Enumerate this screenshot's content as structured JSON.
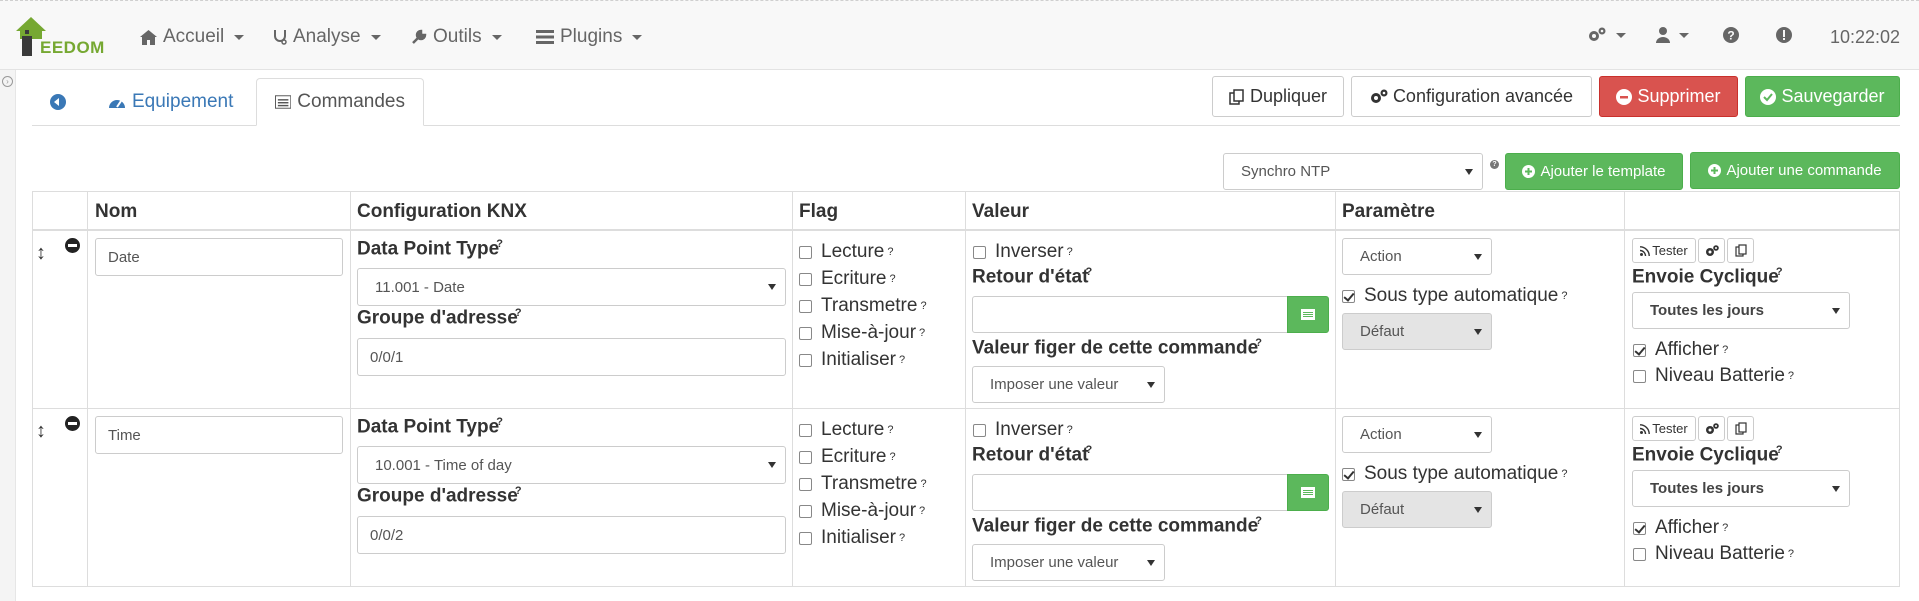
{
  "navbar": {
    "logo_text": "EEDOM",
    "menus": [
      {
        "label": "Accueil",
        "icon": "home-icon"
      },
      {
        "label": "Analyse",
        "icon": "stethoscope-icon"
      },
      {
        "label": "Outils",
        "icon": "wrench-icon"
      },
      {
        "label": "Plugins",
        "icon": "tasks-icon"
      }
    ],
    "time": "10:22:02"
  },
  "tabs": {
    "equipement": "Equipement",
    "commandes": "Commandes"
  },
  "actions": {
    "dupliquer": "Dupliquer",
    "config_avancee": "Configuration avancée",
    "supprimer": "Supprimer",
    "sauvegarder": "Sauvegarder"
  },
  "template_bar": {
    "template_select": "Synchro NTP",
    "add_template": "Ajouter le template",
    "add_command": "Ajouter une commande"
  },
  "table": {
    "headers": [
      "Nom",
      "Configuration KNX",
      "Flag",
      "Valeur",
      "Paramètre",
      ""
    ],
    "labels": {
      "dpt": "Data Point Type",
      "group": "Groupe d'adresse",
      "retour": "Retour d'état",
      "figer": "Valeur figer de cette commande",
      "envoie": "Envoie Cyclique",
      "tester": "Tester"
    },
    "flags": [
      "Lecture",
      "Ecriture",
      "Transmetre",
      "Mise-à-jour",
      "Initialiser"
    ],
    "inverser": "Inverser",
    "sous_type": "Sous type automatique",
    "afficher": "Afficher",
    "batterie": "Niveau Batterie",
    "rows": [
      {
        "nom": "Date",
        "dpt": "11.001 - Date",
        "group": "0/0/1",
        "impose": "Imposer une valeur",
        "type": "Action",
        "subtype": "Défaut",
        "cyclique": "Toutes les jours",
        "flags_checked": [
          false,
          false,
          false,
          false,
          false
        ],
        "inverser_checked": false,
        "sous_type_checked": true,
        "afficher_checked": true,
        "batterie_checked": false
      },
      {
        "nom": "Time",
        "dpt": "10.001 - Time of day",
        "group": "0/0/2",
        "impose": "Imposer une valeur",
        "type": "Action",
        "subtype": "Défaut",
        "cyclique": "Toutes les jours",
        "flags_checked": [
          false,
          false,
          false,
          false,
          false
        ],
        "inverser_checked": false,
        "sous_type_checked": true,
        "afficher_checked": true,
        "batterie_checked": false
      }
    ]
  }
}
